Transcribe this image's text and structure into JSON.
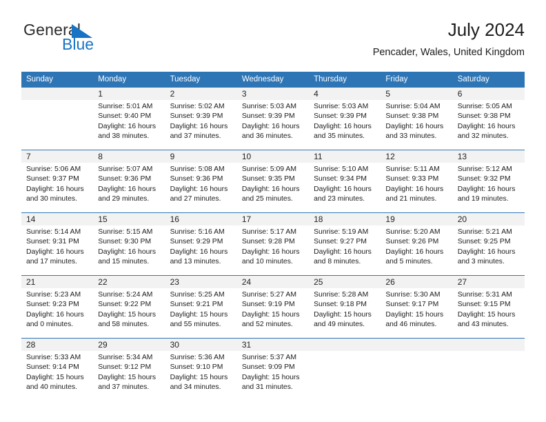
{
  "brand": {
    "name_part1": "General",
    "name_part2": "Blue",
    "triangle_color": "#1773c4",
    "blue_text_color": "#1773c4"
  },
  "header": {
    "title": "July 2024",
    "subtitle": "Pencader, Wales, United Kingdom"
  },
  "theme": {
    "header_blue": "#2e75b6",
    "daynum_band": "#f2f2f2",
    "text": "#1b1b1b"
  },
  "calendar": {
    "weekday_headers": [
      "Sunday",
      "Monday",
      "Tuesday",
      "Wednesday",
      "Thursday",
      "Friday",
      "Saturday"
    ],
    "weeks": [
      [
        {
          "day": "",
          "l1": "",
          "l2": "",
          "l3": "",
          "l4": ""
        },
        {
          "day": "1",
          "l1": "Sunrise: 5:01 AM",
          "l2": "Sunset: 9:40 PM",
          "l3": "Daylight: 16 hours",
          "l4": "and 38 minutes."
        },
        {
          "day": "2",
          "l1": "Sunrise: 5:02 AM",
          "l2": "Sunset: 9:39 PM",
          "l3": "Daylight: 16 hours",
          "l4": "and 37 minutes."
        },
        {
          "day": "3",
          "l1": "Sunrise: 5:03 AM",
          "l2": "Sunset: 9:39 PM",
          "l3": "Daylight: 16 hours",
          "l4": "and 36 minutes."
        },
        {
          "day": "4",
          "l1": "Sunrise: 5:03 AM",
          "l2": "Sunset: 9:39 PM",
          "l3": "Daylight: 16 hours",
          "l4": "and 35 minutes."
        },
        {
          "day": "5",
          "l1": "Sunrise: 5:04 AM",
          "l2": "Sunset: 9:38 PM",
          "l3": "Daylight: 16 hours",
          "l4": "and 33 minutes."
        },
        {
          "day": "6",
          "l1": "Sunrise: 5:05 AM",
          "l2": "Sunset: 9:38 PM",
          "l3": "Daylight: 16 hours",
          "l4": "and 32 minutes."
        }
      ],
      [
        {
          "day": "7",
          "l1": "Sunrise: 5:06 AM",
          "l2": "Sunset: 9:37 PM",
          "l3": "Daylight: 16 hours",
          "l4": "and 30 minutes."
        },
        {
          "day": "8",
          "l1": "Sunrise: 5:07 AM",
          "l2": "Sunset: 9:36 PM",
          "l3": "Daylight: 16 hours",
          "l4": "and 29 minutes."
        },
        {
          "day": "9",
          "l1": "Sunrise: 5:08 AM",
          "l2": "Sunset: 9:36 PM",
          "l3": "Daylight: 16 hours",
          "l4": "and 27 minutes."
        },
        {
          "day": "10",
          "l1": "Sunrise: 5:09 AM",
          "l2": "Sunset: 9:35 PM",
          "l3": "Daylight: 16 hours",
          "l4": "and 25 minutes."
        },
        {
          "day": "11",
          "l1": "Sunrise: 5:10 AM",
          "l2": "Sunset: 9:34 PM",
          "l3": "Daylight: 16 hours",
          "l4": "and 23 minutes."
        },
        {
          "day": "12",
          "l1": "Sunrise: 5:11 AM",
          "l2": "Sunset: 9:33 PM",
          "l3": "Daylight: 16 hours",
          "l4": "and 21 minutes."
        },
        {
          "day": "13",
          "l1": "Sunrise: 5:12 AM",
          "l2": "Sunset: 9:32 PM",
          "l3": "Daylight: 16 hours",
          "l4": "and 19 minutes."
        }
      ],
      [
        {
          "day": "14",
          "l1": "Sunrise: 5:14 AM",
          "l2": "Sunset: 9:31 PM",
          "l3": "Daylight: 16 hours",
          "l4": "and 17 minutes."
        },
        {
          "day": "15",
          "l1": "Sunrise: 5:15 AM",
          "l2": "Sunset: 9:30 PM",
          "l3": "Daylight: 16 hours",
          "l4": "and 15 minutes."
        },
        {
          "day": "16",
          "l1": "Sunrise: 5:16 AM",
          "l2": "Sunset: 9:29 PM",
          "l3": "Daylight: 16 hours",
          "l4": "and 13 minutes."
        },
        {
          "day": "17",
          "l1": "Sunrise: 5:17 AM",
          "l2": "Sunset: 9:28 PM",
          "l3": "Daylight: 16 hours",
          "l4": "and 10 minutes."
        },
        {
          "day": "18",
          "l1": "Sunrise: 5:19 AM",
          "l2": "Sunset: 9:27 PM",
          "l3": "Daylight: 16 hours",
          "l4": "and 8 minutes."
        },
        {
          "day": "19",
          "l1": "Sunrise: 5:20 AM",
          "l2": "Sunset: 9:26 PM",
          "l3": "Daylight: 16 hours",
          "l4": "and 5 minutes."
        },
        {
          "day": "20",
          "l1": "Sunrise: 5:21 AM",
          "l2": "Sunset: 9:25 PM",
          "l3": "Daylight: 16 hours",
          "l4": "and 3 minutes."
        }
      ],
      [
        {
          "day": "21",
          "l1": "Sunrise: 5:23 AM",
          "l2": "Sunset: 9:23 PM",
          "l3": "Daylight: 16 hours",
          "l4": "and 0 minutes."
        },
        {
          "day": "22",
          "l1": "Sunrise: 5:24 AM",
          "l2": "Sunset: 9:22 PM",
          "l3": "Daylight: 15 hours",
          "l4": "and 58 minutes."
        },
        {
          "day": "23",
          "l1": "Sunrise: 5:25 AM",
          "l2": "Sunset: 9:21 PM",
          "l3": "Daylight: 15 hours",
          "l4": "and 55 minutes."
        },
        {
          "day": "24",
          "l1": "Sunrise: 5:27 AM",
          "l2": "Sunset: 9:19 PM",
          "l3": "Daylight: 15 hours",
          "l4": "and 52 minutes."
        },
        {
          "day": "25",
          "l1": "Sunrise: 5:28 AM",
          "l2": "Sunset: 9:18 PM",
          "l3": "Daylight: 15 hours",
          "l4": "and 49 minutes."
        },
        {
          "day": "26",
          "l1": "Sunrise: 5:30 AM",
          "l2": "Sunset: 9:17 PM",
          "l3": "Daylight: 15 hours",
          "l4": "and 46 minutes."
        },
        {
          "day": "27",
          "l1": "Sunrise: 5:31 AM",
          "l2": "Sunset: 9:15 PM",
          "l3": "Daylight: 15 hours",
          "l4": "and 43 minutes."
        }
      ],
      [
        {
          "day": "28",
          "l1": "Sunrise: 5:33 AM",
          "l2": "Sunset: 9:14 PM",
          "l3": "Daylight: 15 hours",
          "l4": "and 40 minutes."
        },
        {
          "day": "29",
          "l1": "Sunrise: 5:34 AM",
          "l2": "Sunset: 9:12 PM",
          "l3": "Daylight: 15 hours",
          "l4": "and 37 minutes."
        },
        {
          "day": "30",
          "l1": "Sunrise: 5:36 AM",
          "l2": "Sunset: 9:10 PM",
          "l3": "Daylight: 15 hours",
          "l4": "and 34 minutes."
        },
        {
          "day": "31",
          "l1": "Sunrise: 5:37 AM",
          "l2": "Sunset: 9:09 PM",
          "l3": "Daylight: 15 hours",
          "l4": "and 31 minutes."
        },
        {
          "day": "",
          "l1": "",
          "l2": "",
          "l3": "",
          "l4": ""
        },
        {
          "day": "",
          "l1": "",
          "l2": "",
          "l3": "",
          "l4": ""
        },
        {
          "day": "",
          "l1": "",
          "l2": "",
          "l3": "",
          "l4": ""
        }
      ]
    ]
  }
}
